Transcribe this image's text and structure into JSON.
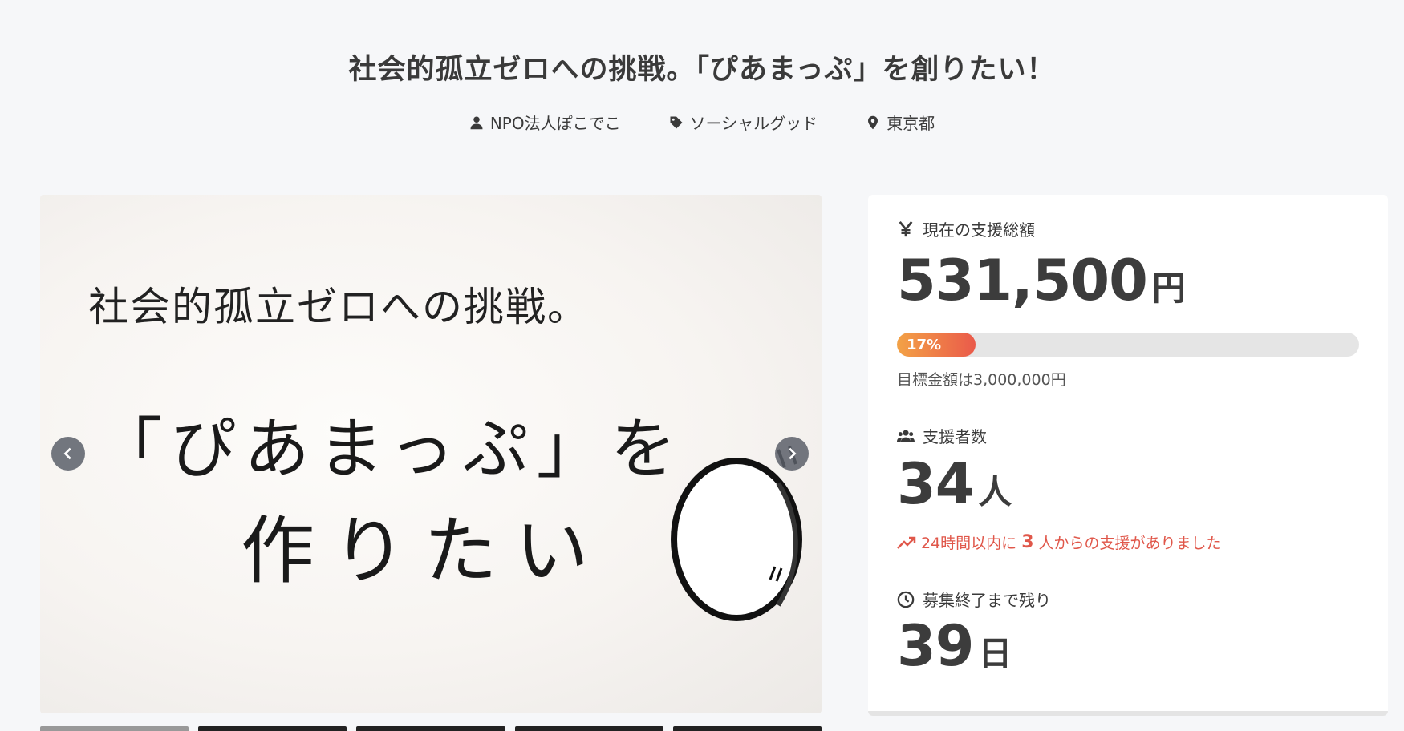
{
  "project": {
    "title": "社会的孤立ゼロへの挑戦。「ぴあまっぷ」を創りたい！",
    "owner": "NPO法人ぽこでこ",
    "category": "ソーシャルグッド",
    "location": "東京都"
  },
  "hero": {
    "line1": "社会的孤立ゼロへの挑戦。",
    "line2": "「ぴあまっぷ」を",
    "line3": "作りたい"
  },
  "funding": {
    "label": "現在の支援総額",
    "currency_icon": "yen-icon",
    "amount": "531,500",
    "unit": "円",
    "progress_percent": 17,
    "progress_label": "17%",
    "goal_text": "目標金額は3,000,000円"
  },
  "supporters": {
    "label": "支援者数",
    "count": "34",
    "unit": "人",
    "trend_prefix": "24時間以内に",
    "trend_count": "3",
    "trend_suffix": "人からの支援がありました"
  },
  "remaining": {
    "label": "募集終了まで残り",
    "days": "39",
    "unit": "日"
  },
  "colors": {
    "accent_start": "#f3a246",
    "accent_end": "#ea5a4a",
    "trend": "#e0574a"
  }
}
